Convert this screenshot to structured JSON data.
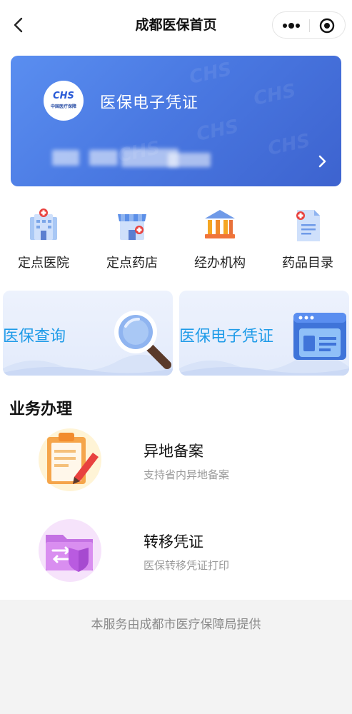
{
  "navbar": {
    "title": "成都医保首页",
    "back_icon": "chevron-left-icon",
    "more_icon": "more-dots-icon",
    "close_icon": "target-close-icon"
  },
  "card": {
    "title": "医保电子凭证",
    "logo_text": "CHS",
    "logo_org": "中国医疗保障",
    "arrow_icon": "chevron-right-icon"
  },
  "quick_nav": [
    {
      "label": "定点医院",
      "icon": "hospital-icon"
    },
    {
      "label": "定点药店",
      "icon": "pharmacy-icon"
    },
    {
      "label": "经办机构",
      "icon": "institution-icon"
    },
    {
      "label": "药品目录",
      "icon": "drug-catalog-icon"
    }
  ],
  "banners": [
    {
      "label": "医保查询",
      "icon": "magnifier-icon"
    },
    {
      "label": "医保电子凭证",
      "icon": "id-card-icon"
    }
  ],
  "section": {
    "title": "业务办理"
  },
  "services": [
    {
      "name": "异地备案",
      "desc": "支持省内异地备案",
      "icon": "clipboard-edit-icon"
    },
    {
      "name": "转移凭证",
      "desc": "医保转移凭证打印",
      "icon": "folder-transfer-icon"
    }
  ],
  "footer": {
    "text": "本服务由成都市医疗保障局提供"
  },
  "colors": {
    "card_blue": "#4a79e2",
    "banner_text": "#1e9be8",
    "accent_red": "#e8413e"
  }
}
